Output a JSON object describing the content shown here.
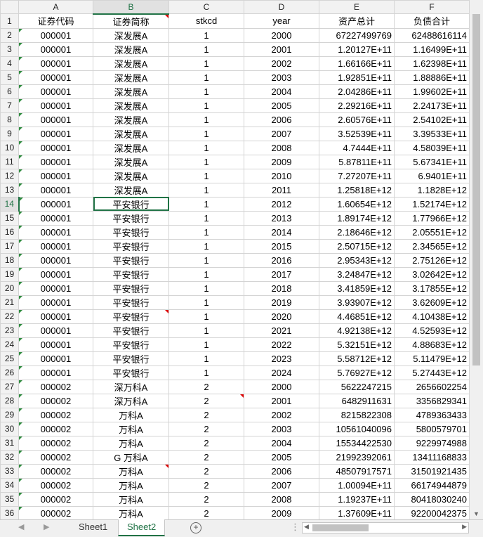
{
  "columns": [
    "A",
    "B",
    "C",
    "D",
    "E",
    "F"
  ],
  "header_row": [
    "证券代码",
    "证券简称",
    "stkcd",
    "year",
    "资产总计",
    "负债合计"
  ],
  "rows": [
    [
      "000001",
      "深发展A",
      "1",
      "2000",
      "67227499769",
      "62488616114"
    ],
    [
      "000001",
      "深发展A",
      "1",
      "2001",
      "1.20127E+11",
      "1.16499E+11"
    ],
    [
      "000001",
      "深发展A",
      "1",
      "2002",
      "1.66166E+11",
      "1.62398E+11"
    ],
    [
      "000001",
      "深发展A",
      "1",
      "2003",
      "1.92851E+11",
      "1.88886E+11"
    ],
    [
      "000001",
      "深发展A",
      "1",
      "2004",
      "2.04286E+11",
      "1.99602E+11"
    ],
    [
      "000001",
      "深发展A",
      "1",
      "2005",
      "2.29216E+11",
      "2.24173E+11"
    ],
    [
      "000001",
      "深发展A",
      "1",
      "2006",
      "2.60576E+11",
      "2.54102E+11"
    ],
    [
      "000001",
      "深发展A",
      "1",
      "2007",
      "3.52539E+11",
      "3.39533E+11"
    ],
    [
      "000001",
      "深发展A",
      "1",
      "2008",
      "4.7444E+11",
      "4.58039E+11"
    ],
    [
      "000001",
      "深发展A",
      "1",
      "2009",
      "5.87811E+11",
      "5.67341E+11"
    ],
    [
      "000001",
      "深发展A",
      "1",
      "2010",
      "7.27207E+11",
      "6.9401E+11"
    ],
    [
      "000001",
      "深发展A",
      "1",
      "2011",
      "1.25818E+12",
      "1.1828E+12"
    ],
    [
      "000001",
      "平安银行",
      "1",
      "2012",
      "1.60654E+12",
      "1.52174E+12"
    ],
    [
      "000001",
      "平安银行",
      "1",
      "2013",
      "1.89174E+12",
      "1.77966E+12"
    ],
    [
      "000001",
      "平安银行",
      "1",
      "2014",
      "2.18646E+12",
      "2.05551E+12"
    ],
    [
      "000001",
      "平安银行",
      "1",
      "2015",
      "2.50715E+12",
      "2.34565E+12"
    ],
    [
      "000001",
      "平安银行",
      "1",
      "2016",
      "2.95343E+12",
      "2.75126E+12"
    ],
    [
      "000001",
      "平安银行",
      "1",
      "2017",
      "3.24847E+12",
      "3.02642E+12"
    ],
    [
      "000001",
      "平安银行",
      "1",
      "2018",
      "3.41859E+12",
      "3.17855E+12"
    ],
    [
      "000001",
      "平安银行",
      "1",
      "2019",
      "3.93907E+12",
      "3.62609E+12"
    ],
    [
      "000001",
      "平安银行",
      "1",
      "2020",
      "4.46851E+12",
      "4.10438E+12"
    ],
    [
      "000001",
      "平安银行",
      "1",
      "2021",
      "4.92138E+12",
      "4.52593E+12"
    ],
    [
      "000001",
      "平安银行",
      "1",
      "2022",
      "5.32151E+12",
      "4.88683E+12"
    ],
    [
      "000001",
      "平安银行",
      "1",
      "2023",
      "5.58712E+12",
      "5.11479E+12"
    ],
    [
      "000001",
      "平安银行",
      "1",
      "2024",
      "5.76927E+12",
      "5.27443E+12"
    ],
    [
      "000002",
      "深万科A",
      "2",
      "2000",
      "5622247215",
      "2656602254"
    ],
    [
      "000002",
      "深万科A",
      "2",
      "2001",
      "6482911631",
      "3356829341"
    ],
    [
      "000002",
      "万科A",
      "2",
      "2002",
      "8215822308",
      "4789363433"
    ],
    [
      "000002",
      "万科A",
      "2",
      "2003",
      "10561040096",
      "5800579701"
    ],
    [
      "000002",
      "万科A",
      "2",
      "2004",
      "15534422530",
      "9229974988"
    ],
    [
      "000002",
      "G 万科A",
      "2",
      "2005",
      "21992392061",
      "13411168833"
    ],
    [
      "000002",
      "万科A",
      "2",
      "2006",
      "48507917571",
      "31501921435"
    ],
    [
      "000002",
      "万科A",
      "2",
      "2007",
      "1.00094E+11",
      "66174944879"
    ],
    [
      "000002",
      "万科A",
      "2",
      "2008",
      "1.19237E+11",
      "80418030240"
    ],
    [
      "000002",
      "万科A",
      "2",
      "2009",
      "1.37609E+11",
      "92200042375"
    ]
  ],
  "tabs": [
    "Sheet1",
    "Sheet2"
  ],
  "active_tab": "Sheet2",
  "active_cell": "B14",
  "accent_color": "#217346"
}
